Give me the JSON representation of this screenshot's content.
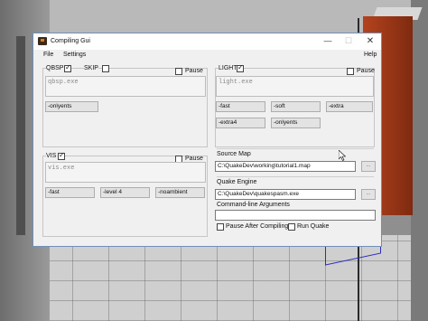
{
  "window": {
    "title": "Compiling Gui"
  },
  "menubar": {
    "file": "File",
    "settings": "Settings",
    "help": "Help"
  },
  "qbsp": {
    "label": "QBSP",
    "checked": true,
    "skip_label": "SKIP",
    "skip_checked": false,
    "pause_label": "Pause",
    "exe": "qbsp.exe",
    "options": [
      "-onlyents"
    ]
  },
  "light": {
    "label": "LIGHT",
    "checked": true,
    "pause_label": "Pause",
    "exe": "light.exe",
    "options": [
      "-fast",
      "-soft",
      "-extra",
      "-extra4",
      "-onlyents"
    ]
  },
  "vis": {
    "label": "VIS",
    "checked": true,
    "pause_label": "Pause",
    "exe": "vis.exe",
    "options": [
      "-fast",
      "-level 4",
      "-noambient"
    ]
  },
  "source_map": {
    "label": "Source Map",
    "value": "C:\\QuakeDev\\working\\tutorial1.map",
    "browse": "..."
  },
  "quake_engine": {
    "label": "Quake Engine",
    "value": "C:\\QuakeDev\\quakespasm.exe",
    "browse": "..."
  },
  "command_line": {
    "label": "Command-line Arguments",
    "value": ""
  },
  "pause_after": {
    "label": "Pause After Compiling",
    "checked": false
  },
  "run_quake": {
    "label": "Run Quake",
    "checked": false
  }
}
